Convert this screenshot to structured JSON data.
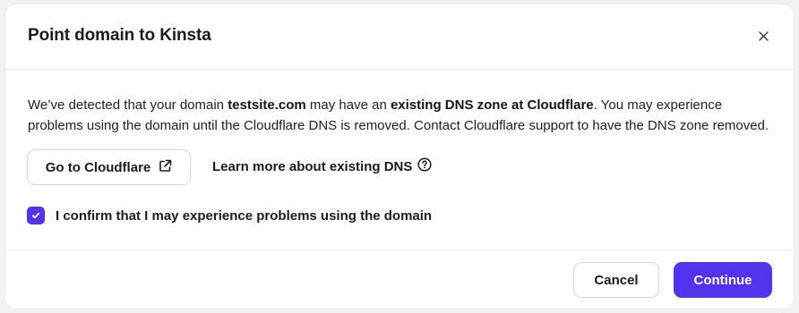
{
  "dialog": {
    "title": "Point domain to Kinsta",
    "close_icon": "close-icon"
  },
  "notice": {
    "part1": "We’ve detected that your domain ",
    "domain": "testsite.com",
    "part2": " may have an ",
    "highlight": "existing DNS zone at Cloudflare",
    "part3": ". You may experience problems using the domain until the Cloudflare DNS is removed. Contact Cloudflare support to have the DNS zone removed."
  },
  "actions": {
    "cloudflare_button_label": "Go to Cloudflare",
    "cloudflare_button_icon": "external-link-icon",
    "learn_more_label": "Learn more about existing DNS",
    "learn_more_icon": "help-circle-icon"
  },
  "confirm": {
    "checked": true,
    "label": "I confirm that I may experience problems using the domain"
  },
  "footer": {
    "cancel_label": "Cancel",
    "continue_label": "Continue"
  },
  "colors": {
    "accent": "#5333ed",
    "text": "#1b1b21",
    "border": "#d6d6dc"
  }
}
